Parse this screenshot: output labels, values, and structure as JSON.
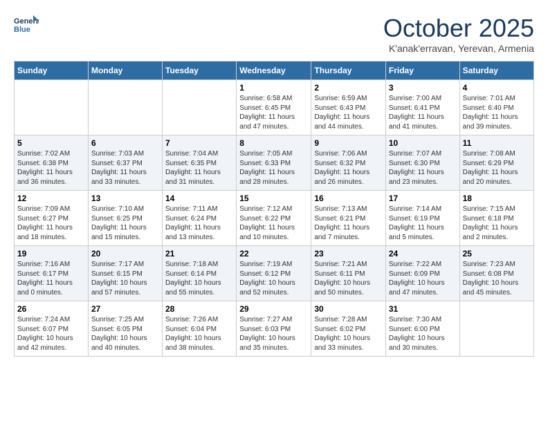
{
  "header": {
    "logo_line1": "General",
    "logo_line2": "Blue",
    "month_title": "October 2025",
    "subtitle": "K'anak'erravan, Yerevan, Armenia"
  },
  "days_of_week": [
    "Sunday",
    "Monday",
    "Tuesday",
    "Wednesday",
    "Thursday",
    "Friday",
    "Saturday"
  ],
  "weeks": [
    [
      {
        "day": "",
        "info": ""
      },
      {
        "day": "",
        "info": ""
      },
      {
        "day": "",
        "info": ""
      },
      {
        "day": "1",
        "info": "Sunrise: 6:58 AM\nSunset: 6:45 PM\nDaylight: 11 hours and 47 minutes."
      },
      {
        "day": "2",
        "info": "Sunrise: 6:59 AM\nSunset: 6:43 PM\nDaylight: 11 hours and 44 minutes."
      },
      {
        "day": "3",
        "info": "Sunrise: 7:00 AM\nSunset: 6:41 PM\nDaylight: 11 hours and 41 minutes."
      },
      {
        "day": "4",
        "info": "Sunrise: 7:01 AM\nSunset: 6:40 PM\nDaylight: 11 hours and 39 minutes."
      }
    ],
    [
      {
        "day": "5",
        "info": "Sunrise: 7:02 AM\nSunset: 6:38 PM\nDaylight: 11 hours and 36 minutes."
      },
      {
        "day": "6",
        "info": "Sunrise: 7:03 AM\nSunset: 6:37 PM\nDaylight: 11 hours and 33 minutes."
      },
      {
        "day": "7",
        "info": "Sunrise: 7:04 AM\nSunset: 6:35 PM\nDaylight: 11 hours and 31 minutes."
      },
      {
        "day": "8",
        "info": "Sunrise: 7:05 AM\nSunset: 6:33 PM\nDaylight: 11 hours and 28 minutes."
      },
      {
        "day": "9",
        "info": "Sunrise: 7:06 AM\nSunset: 6:32 PM\nDaylight: 11 hours and 26 minutes."
      },
      {
        "day": "10",
        "info": "Sunrise: 7:07 AM\nSunset: 6:30 PM\nDaylight: 11 hours and 23 minutes."
      },
      {
        "day": "11",
        "info": "Sunrise: 7:08 AM\nSunset: 6:29 PM\nDaylight: 11 hours and 20 minutes."
      }
    ],
    [
      {
        "day": "12",
        "info": "Sunrise: 7:09 AM\nSunset: 6:27 PM\nDaylight: 11 hours and 18 minutes."
      },
      {
        "day": "13",
        "info": "Sunrise: 7:10 AM\nSunset: 6:25 PM\nDaylight: 11 hours and 15 minutes."
      },
      {
        "day": "14",
        "info": "Sunrise: 7:11 AM\nSunset: 6:24 PM\nDaylight: 11 hours and 13 minutes."
      },
      {
        "day": "15",
        "info": "Sunrise: 7:12 AM\nSunset: 6:22 PM\nDaylight: 11 hours and 10 minutes."
      },
      {
        "day": "16",
        "info": "Sunrise: 7:13 AM\nSunset: 6:21 PM\nDaylight: 11 hours and 7 minutes."
      },
      {
        "day": "17",
        "info": "Sunrise: 7:14 AM\nSunset: 6:19 PM\nDaylight: 11 hours and 5 minutes."
      },
      {
        "day": "18",
        "info": "Sunrise: 7:15 AM\nSunset: 6:18 PM\nDaylight: 11 hours and 2 minutes."
      }
    ],
    [
      {
        "day": "19",
        "info": "Sunrise: 7:16 AM\nSunset: 6:17 PM\nDaylight: 11 hours and 0 minutes."
      },
      {
        "day": "20",
        "info": "Sunrise: 7:17 AM\nSunset: 6:15 PM\nDaylight: 10 hours and 57 minutes."
      },
      {
        "day": "21",
        "info": "Sunrise: 7:18 AM\nSunset: 6:14 PM\nDaylight: 10 hours and 55 minutes."
      },
      {
        "day": "22",
        "info": "Sunrise: 7:19 AM\nSunset: 6:12 PM\nDaylight: 10 hours and 52 minutes."
      },
      {
        "day": "23",
        "info": "Sunrise: 7:21 AM\nSunset: 6:11 PM\nDaylight: 10 hours and 50 minutes."
      },
      {
        "day": "24",
        "info": "Sunrise: 7:22 AM\nSunset: 6:09 PM\nDaylight: 10 hours and 47 minutes."
      },
      {
        "day": "25",
        "info": "Sunrise: 7:23 AM\nSunset: 6:08 PM\nDaylight: 10 hours and 45 minutes."
      }
    ],
    [
      {
        "day": "26",
        "info": "Sunrise: 7:24 AM\nSunset: 6:07 PM\nDaylight: 10 hours and 42 minutes."
      },
      {
        "day": "27",
        "info": "Sunrise: 7:25 AM\nSunset: 6:05 PM\nDaylight: 10 hours and 40 minutes."
      },
      {
        "day": "28",
        "info": "Sunrise: 7:26 AM\nSunset: 6:04 PM\nDaylight: 10 hours and 38 minutes."
      },
      {
        "day": "29",
        "info": "Sunrise: 7:27 AM\nSunset: 6:03 PM\nDaylight: 10 hours and 35 minutes."
      },
      {
        "day": "30",
        "info": "Sunrise: 7:28 AM\nSunset: 6:02 PM\nDaylight: 10 hours and 33 minutes."
      },
      {
        "day": "31",
        "info": "Sunrise: 7:30 AM\nSunset: 6:00 PM\nDaylight: 10 hours and 30 minutes."
      },
      {
        "day": "",
        "info": ""
      }
    ]
  ]
}
